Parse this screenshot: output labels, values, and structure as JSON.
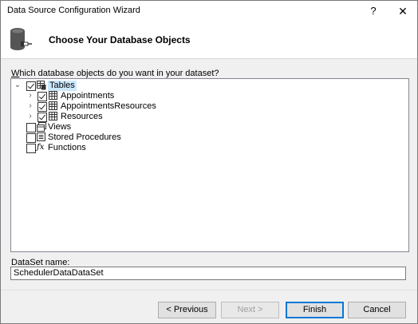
{
  "window": {
    "title": "Data Source Configuration Wizard",
    "help": "?",
    "close": "✕"
  },
  "header": {
    "title": "Choose Your Database Objects"
  },
  "prompt": "Which database objects do you want in your dataset?",
  "tree": {
    "tables": {
      "label": "Tables",
      "checked": true,
      "expanded": true,
      "children": [
        {
          "label": "Appointments",
          "checked": true
        },
        {
          "label": "AppointmentsResources",
          "checked": true
        },
        {
          "label": "Resources",
          "checked": true
        }
      ]
    },
    "views": {
      "label": "Views",
      "checked": false
    },
    "procs": {
      "label": "Stored Procedures",
      "checked": false
    },
    "funcs": {
      "label": "Functions",
      "checked": false
    }
  },
  "dataset": {
    "label": "DataSet name:",
    "value": "SchedulerDataDataSet"
  },
  "buttons": {
    "previous": "< Previous",
    "next": "Next >",
    "finish": "Finish",
    "cancel": "Cancel"
  }
}
